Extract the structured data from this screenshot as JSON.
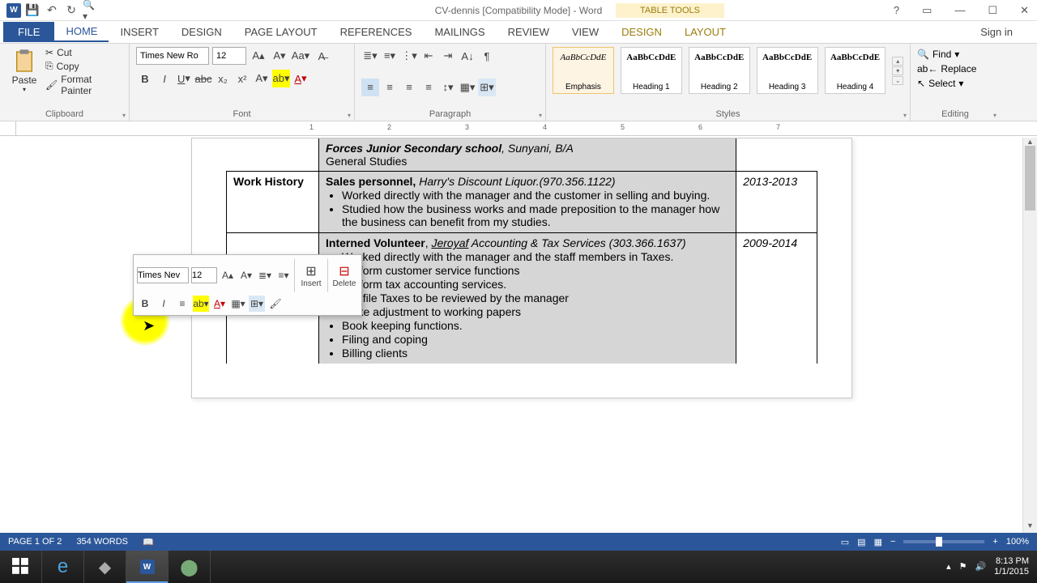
{
  "title": "CV-dennis [Compatibility Mode] - Word",
  "table_tools": "TABLE TOOLS",
  "sign_in": "Sign in",
  "tabs": {
    "file": "FILE",
    "home": "HOME",
    "insert": "INSERT",
    "design": "DESIGN",
    "page_layout": "PAGE LAYOUT",
    "references": "REFERENCES",
    "mailings": "MAILINGS",
    "review": "REVIEW",
    "view": "VIEW",
    "tt_design": "DESIGN",
    "tt_layout": "LAYOUT"
  },
  "clipboard": {
    "paste": "Paste",
    "cut": "Cut",
    "copy": "Copy",
    "format_painter": "Format Painter",
    "label": "Clipboard"
  },
  "font": {
    "name": "Times New Ro",
    "size": "12",
    "label": "Font"
  },
  "paragraph": {
    "label": "Paragraph"
  },
  "styles": {
    "label": "Styles",
    "preview": "AaBbCcDdE",
    "items": [
      "Emphasis",
      "Heading 1",
      "Heading 2",
      "Heading 3",
      "Heading 4"
    ]
  },
  "editing": {
    "find": "Find",
    "replace": "Replace",
    "select": "Select",
    "label": "Editing"
  },
  "mini": {
    "font": "Times Nev",
    "size": "12",
    "insert": "Insert",
    "delete": "Delete"
  },
  "doc": {
    "prev_school": "Forces Junior Secondary school",
    "prev_school_loc": ", Sunyani, B/A",
    "prev_studies": "General Studies",
    "wh_label": "Work History",
    "job1_title": "Sales personnel,",
    "job1_company": " Harry's Discount Liquor.(970.356.1122)",
    "job1_b1": "Worked directly with the manager and the customer in selling and buying.",
    "job1_b2": "Studied how the business works and made preposition to the manager how the business can benefit from my studies.",
    "job1_years": "2013-2013",
    "job2_title": "Interned Volunteer",
    "job2_sep": ", ",
    "job2_company": "Jeroyaf",
    "job2_company2": " Accounting & Tax Services",
    "job2_phone": " (303.366.1637)",
    "job2_b1": "Worked directly with the manager and the staff members in Taxes.",
    "job2_b2": "Perform customer service functions",
    "job2_b3": "Perform tax accounting services.",
    "job2_b4": "Pre file Taxes to be reviewed by the manager",
    "job2_b5": "Make adjustment to working papers",
    "job2_b6": "Book keeping functions.",
    "job2_b7": "Filing and coping",
    "job2_b8": "Billing clients",
    "job2_years": "2009-2014"
  },
  "status": {
    "page": "PAGE 1 OF 2",
    "words": "354 WORDS",
    "zoom": "100%"
  },
  "tray": {
    "time": "8:13 PM",
    "date": "1/1/2015"
  }
}
